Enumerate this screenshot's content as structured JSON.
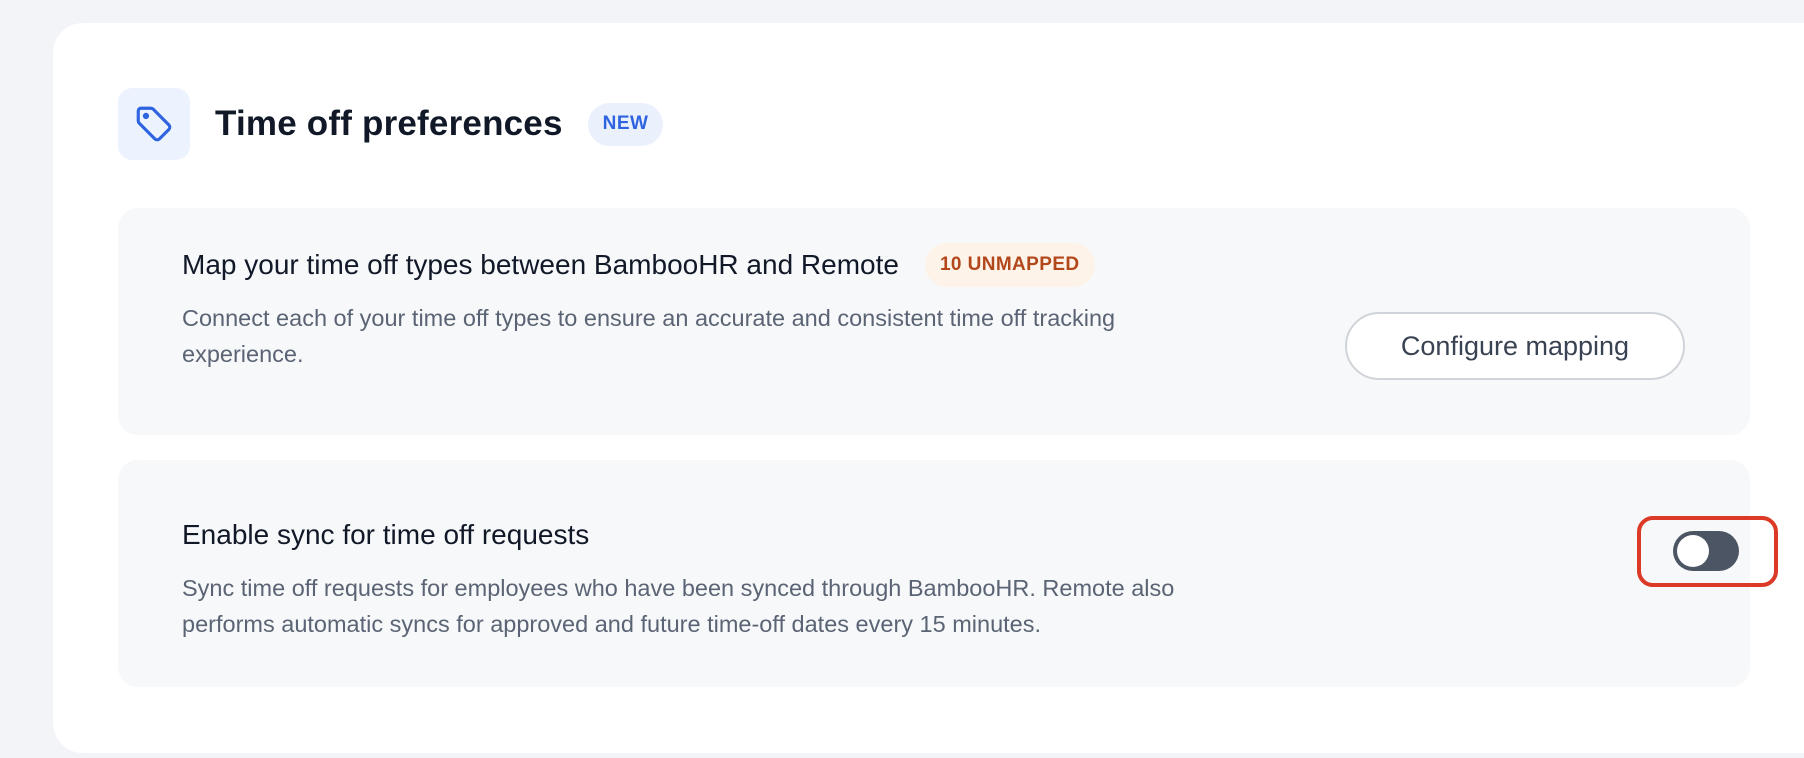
{
  "header": {
    "icon": "tag-icon",
    "title": "Time off preferences",
    "badge": "NEW"
  },
  "mapping_panel": {
    "title": "Map your time off types between BambooHR and Remote",
    "badge": "10 UNMAPPED",
    "description": "Connect each of your time off types to ensure an accurate and consistent time off tracking experience.",
    "button_label": "Configure mapping"
  },
  "sync_panel": {
    "title": "Enable sync for time off requests",
    "description": "Sync time off requests for employees who have been synced through BambooHR. Remote also performs automatic syncs for approved and future time-off dates every 15 minutes.",
    "toggle_on": false
  },
  "colors": {
    "accent": "#2f64e0",
    "badge_warning_text": "#b3471c",
    "toggle_bg": "#4b5563",
    "highlight": "#dc3a26"
  }
}
